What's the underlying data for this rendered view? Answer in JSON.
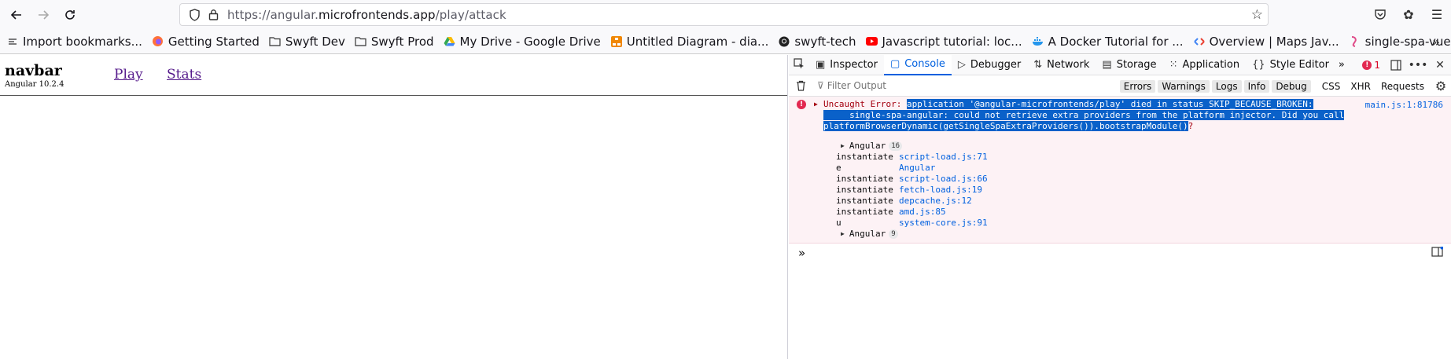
{
  "browser": {
    "url_prefix": "https://angular.",
    "url_domain": "microfrontends.app",
    "url_path": "/play/attack"
  },
  "bookmarks": [
    {
      "label": "Import bookmarks...",
      "icon": "import-icon"
    },
    {
      "label": "Getting Started",
      "icon": "firefox-icon"
    },
    {
      "label": "Swyft Dev",
      "icon": "folder-icon"
    },
    {
      "label": "Swyft Prod",
      "icon": "folder-icon"
    },
    {
      "label": "My Drive - Google Drive",
      "icon": "drive-icon"
    },
    {
      "label": "Untitled Diagram - dia...",
      "icon": "drawio-icon"
    },
    {
      "label": "swyft-tech",
      "icon": "github-icon"
    },
    {
      "label": "Javascript tutorial: loc...",
      "icon": "youtube-icon"
    },
    {
      "label": "A Docker Tutorial for ...",
      "icon": "docker-icon"
    },
    {
      "label": "Overview | Maps Jav...",
      "icon": "maps-icon"
    },
    {
      "label": "single-spa-vue | single...",
      "icon": "single-spa-icon"
    }
  ],
  "page": {
    "brand": "navbar",
    "version": "Angular 10.2.4",
    "links": [
      "Play",
      "Stats"
    ]
  },
  "devtools": {
    "tabs": [
      "Inspector",
      "Console",
      "Debugger",
      "Network",
      "Storage",
      "Application",
      "Style Editor"
    ],
    "active_tab": "Console",
    "error_count": "1",
    "filter_placeholder": "Filter Output",
    "filter_buttons": [
      "Errors",
      "Warnings",
      "Logs",
      "Info",
      "Debug"
    ],
    "extra_filters": [
      "CSS",
      "XHR",
      "Requests"
    ],
    "message": {
      "prefix": "Uncaught Error: ",
      "selected": "application '@angular-microfrontends/play' died in status SKIP_BECAUSE_BROKEN:\n     single-spa-angular: could not retrieve extra providers from the platform injector. Did you call\nplatformBrowserDynamic(getSingleSpaExtraProviders()).bootstrapModule()",
      "suffix": "?",
      "source": "main.js:1:81786",
      "group_top": {
        "label": "Angular",
        "count": "16"
      },
      "stack": [
        {
          "fn": "instantiate",
          "loc": "script-load.js:71"
        },
        {
          "fn": "e",
          "loc": "Angular"
        },
        {
          "fn": "instantiate",
          "loc": "script-load.js:66"
        },
        {
          "fn": "instantiate",
          "loc": "fetch-load.js:19"
        },
        {
          "fn": "instantiate",
          "loc": "depcache.js:12"
        },
        {
          "fn": "instantiate",
          "loc": "amd.js:85"
        },
        {
          "fn": "u",
          "loc": "system-core.js:91"
        }
      ],
      "group_bottom": {
        "label": "Angular",
        "count": "9"
      }
    },
    "prompt_symbol": "»"
  }
}
